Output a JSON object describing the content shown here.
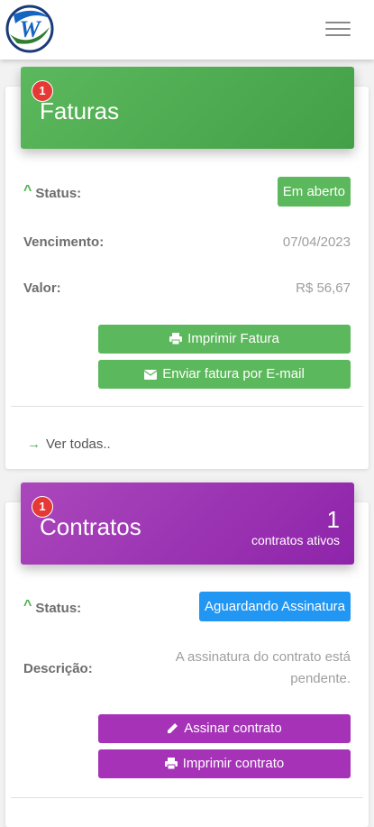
{
  "topbar": {
    "logo_icon": "w-logo-icon",
    "menu_icon": "hamburger-menu-icon"
  },
  "faturas": {
    "badge": "1",
    "title": "Faturas",
    "status_label": "Status:",
    "status_value": "Em aberto",
    "vencimento_label": "Vencimento:",
    "vencimento_value": "07/04/2023",
    "valor_label": "Valor:",
    "valor_value": "R$ 56,67",
    "print_button": "Imprimir Fatura",
    "email_button": "Enviar fatura por E-mail",
    "ver_todas": "Ver todas.."
  },
  "contratos": {
    "badge": "1",
    "title": "Contratos",
    "count": "1",
    "count_label": "contratos ativos",
    "status_label": "Status:",
    "status_value": "Aguardando Assinatura",
    "descricao_label": "Descrição:",
    "descricao_line1": "A assinatura do contrato está",
    "descricao_line2": "pendente.",
    "sign_button": "Assinar contrato",
    "print_button": "Imprimir contrato"
  },
  "colors": {
    "green": "#5cb85c",
    "purple": "#9c27b0",
    "blue": "#2196f3",
    "badge_red": "#e53935"
  }
}
